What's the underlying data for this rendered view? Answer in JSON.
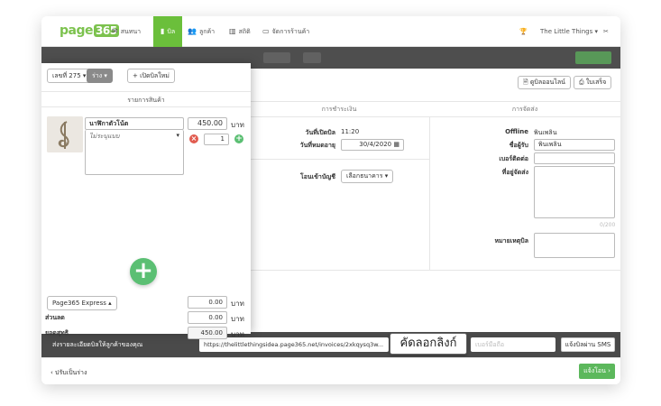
{
  "nav": {
    "logo_text": "page",
    "logo_num": "365",
    "items": [
      {
        "icon": "✉",
        "label": "สนทนา"
      },
      {
        "icon": "▮",
        "label": "บิล"
      },
      {
        "icon": "👥",
        "label": "ลูกค้า"
      },
      {
        "icon": "▥",
        "label": "สถิติ"
      },
      {
        "icon": "▭",
        "label": "จัดการร้านค้า"
      }
    ],
    "shop_name": "The Little Things",
    "trophy_icon": "🏆",
    "tools_icon": "✂"
  },
  "left": {
    "bill_number": "เลขที่ 275",
    "status": "ร่าง",
    "new_bill": "เปิดบิลใหม่",
    "items_title": "รายการสินค้า",
    "item": {
      "name": "นาฬิกาตัวโน้ต",
      "variant": "ไม่ระบุแบบ",
      "price": "450.00",
      "unit": "บาท",
      "qty": "1"
    },
    "shipping_method": "Page365 Express",
    "shipping_cost": "0.00",
    "discount_label": "ส่วนลด",
    "discount": "0.00",
    "net_label": "ยอดสุทธิ",
    "net": "450.00",
    "unit": "บาท"
  },
  "right": {
    "view_online": "ดูบิลออนไลน์",
    "print": "ใบเสร็จ",
    "payment_header": "การชำระเงิน",
    "shipping_header": "การจัดส่ง",
    "opened_label": "วันที่เปิดบิล",
    "opened_value": "11:20",
    "expire_label": "วันที่หมดอายุ",
    "expire_value": "30/4/2020",
    "transfer_label": "โอนเข้าบัญชี",
    "bank_select": "เลือกธนาคาร",
    "offline_label": "Offline",
    "offline_value": "พินเพลิน",
    "recipient_label": "ชื่อผู้รับ",
    "recipient_value": "พินเพลิน",
    "phone_label": "เบอร์ติดต่อ",
    "address_label": "ที่อยู่จัดส่ง",
    "char_count": "0/200",
    "note_label": "หมายเหตุบิล"
  },
  "share": {
    "text": "ส่งรายละเอียดบิลให้ลูกค้าของคุณ",
    "url": "https://thelittlethingsidea.page365.net/invoices/2xkqysq3w...",
    "copy_link": "คัดลอกลิงก์",
    "phone_placeholder": "เบอร์มือถือ",
    "sms_button": "แจ้งบิลผ่าน SMS"
  },
  "footer": {
    "back": "‹ ปรับเป็นร่าง",
    "confirm": "แจ้งโอน ›"
  }
}
